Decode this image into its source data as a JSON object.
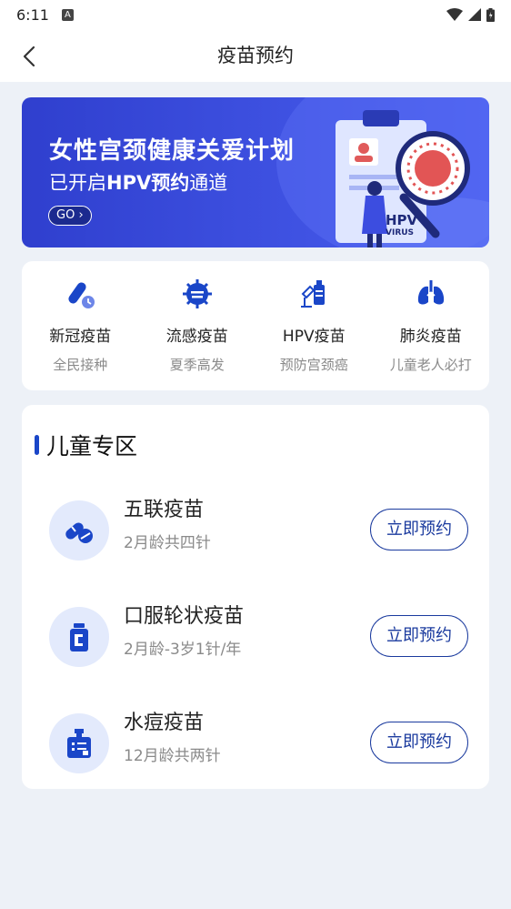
{
  "status_bar": {
    "time": "6:11",
    "notification_glyph": "A"
  },
  "nav": {
    "title": "疫苗预约"
  },
  "banner": {
    "title": "女性宫颈健康关爱计划",
    "sub_prefix": "已开启",
    "sub_bold": "HPV预约",
    "sub_suffix": "通道",
    "go_label": "GO",
    "card_label_1": "HPV",
    "card_label_2": "VIRUS"
  },
  "categories": [
    {
      "name": "新冠疫苗",
      "desc": "全民接种",
      "icon": "test-tube-icon"
    },
    {
      "name": "流感疫苗",
      "desc": "夏季高发",
      "icon": "virus-icon"
    },
    {
      "name": "HPV疫苗",
      "desc": "预防宫颈癌",
      "icon": "syringe-vial-icon"
    },
    {
      "name": "肺炎疫苗",
      "desc": "儿童老人必打",
      "icon": "lungs-icon"
    }
  ],
  "kids_zone": {
    "title": "儿童专区",
    "items": [
      {
        "name": "五联疫苗",
        "desc": "2月龄共四针",
        "button": "立即预约",
        "icon": "pills-icon"
      },
      {
        "name": "口服轮状疫苗",
        "desc": "2月龄-3岁1针/年",
        "button": "立即预约",
        "icon": "bottle-icon"
      },
      {
        "name": "水痘疫苗",
        "desc": "12月龄共两针",
        "button": "立即预约",
        "icon": "vial-icon"
      }
    ]
  },
  "colors": {
    "accent": "#1a46c8",
    "banner_bg": "#3346d6",
    "page_bg": "#edf1f7"
  }
}
